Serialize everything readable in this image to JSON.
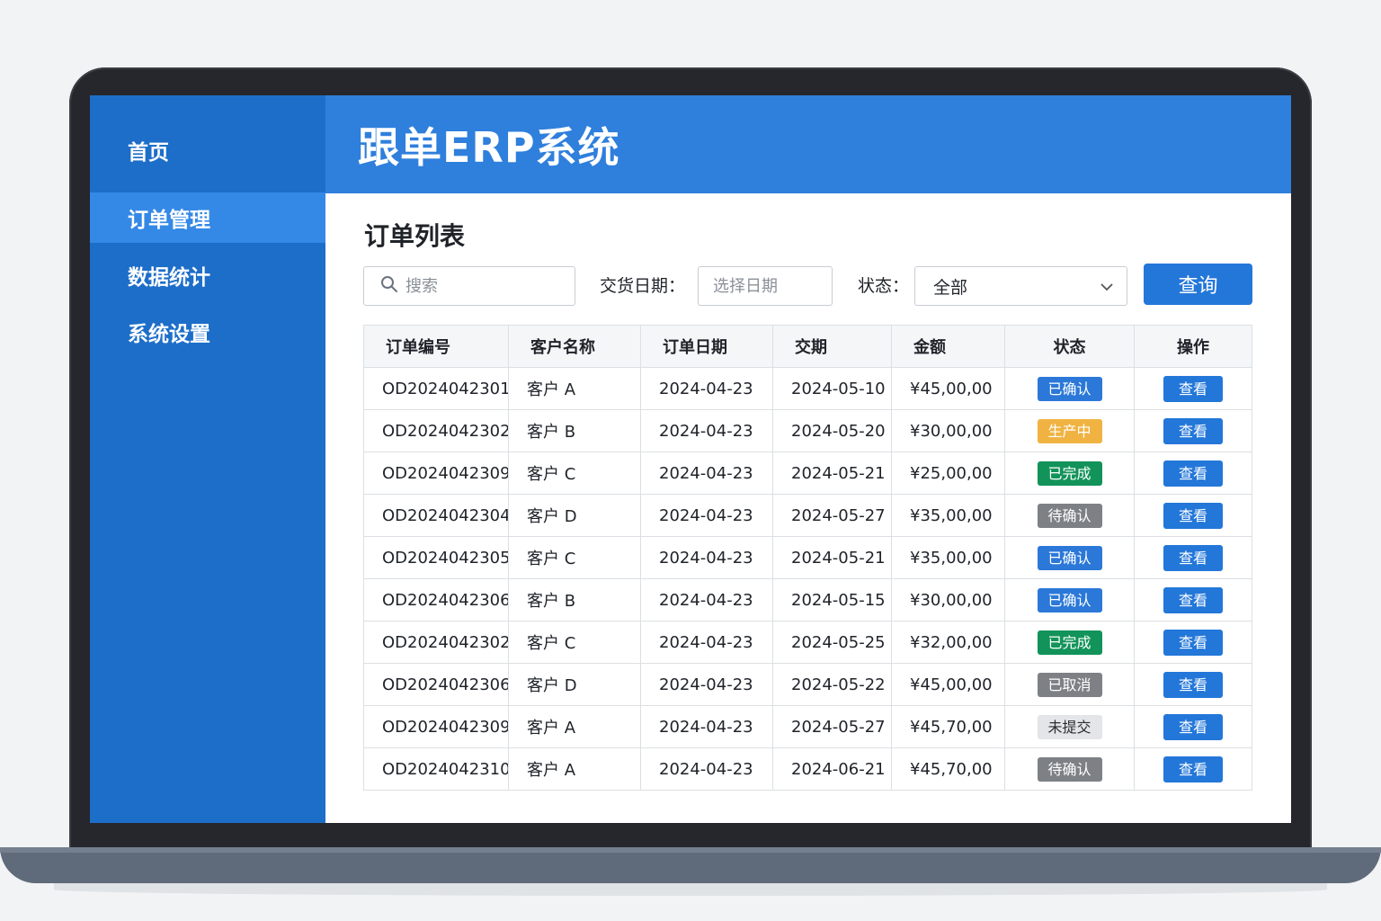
{
  "app": {
    "title": "跟单ERP系统"
  },
  "sidebar": {
    "items": [
      {
        "label": "首页",
        "active": false
      },
      {
        "label": "订单管理",
        "active": true
      },
      {
        "label": "数据统计",
        "active": false
      },
      {
        "label": "系统设置",
        "active": false
      }
    ]
  },
  "page": {
    "title": "订单列表"
  },
  "filters": {
    "search_placeholder": "搜索",
    "date_label": "交货日期：",
    "date_placeholder": "选择日期",
    "status_label": "状态：",
    "status_value": "全部",
    "query_label": "查询"
  },
  "table": {
    "headers": [
      "订单编号",
      "客户名称",
      "订单日期",
      "交期",
      "金额",
      "状态",
      "操作"
    ],
    "rows": [
      {
        "id": "OD2024042301",
        "customer": "客户 A",
        "order_date": "2024-04-23",
        "due": "2024-05-10",
        "amount": "¥45,00,00",
        "status": "已确认",
        "status_color": "#2b78d8",
        "action": "查看"
      },
      {
        "id": "OD2024042302",
        "customer": "客户 B",
        "order_date": "2024-04-23",
        "due": "2024-05-20",
        "amount": "¥30,00,00",
        "status": "生产中",
        "status_color": "#f0b342",
        "action": "查看"
      },
      {
        "id": "OD2024042309",
        "customer": "客户 C",
        "order_date": "2024-04-23",
        "due": "2024-05-21",
        "amount": "¥25,00,00",
        "status": "已完成",
        "status_color": "#12935a",
        "action": "查看"
      },
      {
        "id": "OD2024042304",
        "customer": "客户 D",
        "order_date": "2024-04-23",
        "due": "2024-05-27",
        "amount": "¥35,00,00",
        "status": "待确认",
        "status_color": "#7d8186",
        "action": "查看"
      },
      {
        "id": "OD2024042305",
        "customer": "客户 C",
        "order_date": "2024-04-23",
        "due": "2024-05-21",
        "amount": "¥35,00,00",
        "status": "已确认",
        "status_color": "#2b78d8",
        "action": "查看"
      },
      {
        "id": "OD2024042306",
        "customer": "客户 B",
        "order_date": "2024-04-23",
        "due": "2024-05-15",
        "amount": "¥30,00,00",
        "status": "已确认",
        "status_color": "#2b78d8",
        "action": "查看"
      },
      {
        "id": "OD2024042302",
        "customer": "客户 C",
        "order_date": "2024-04-23",
        "due": "2024-05-25",
        "amount": "¥32,00,00",
        "status": "已完成",
        "status_color": "#12935a",
        "action": "查看"
      },
      {
        "id": "OD2024042306",
        "customer": "客户 D",
        "order_date": "2024-04-23",
        "due": "2024-05-22",
        "amount": "¥45,00,00",
        "status": "已取消",
        "status_color": "#7d8186",
        "action": "查看"
      },
      {
        "id": "OD2024042309",
        "customer": "客户 A",
        "order_date": "2024-04-23",
        "due": "2024-05-27",
        "amount": "¥45,70,00",
        "status": "未提交",
        "status_color": "#e3e5e8",
        "status_text_color": "#2a2d33",
        "action": "查看"
      },
      {
        "id": "OD2024042310",
        "customer": "客户 A",
        "order_date": "2024-04-23",
        "due": "2024-06-21",
        "amount": "¥45,70,00",
        "status": "待确认",
        "status_color": "#7d8186",
        "action": "查看"
      }
    ]
  },
  "colors": {
    "sidebar": "#1d6ec9",
    "sidebar_active": "#3489e6",
    "header": "#2f7fdc",
    "primary_button": "#2377d9"
  },
  "icons": {
    "search": "search-icon",
    "dropdown": "chevron-down-icon"
  }
}
